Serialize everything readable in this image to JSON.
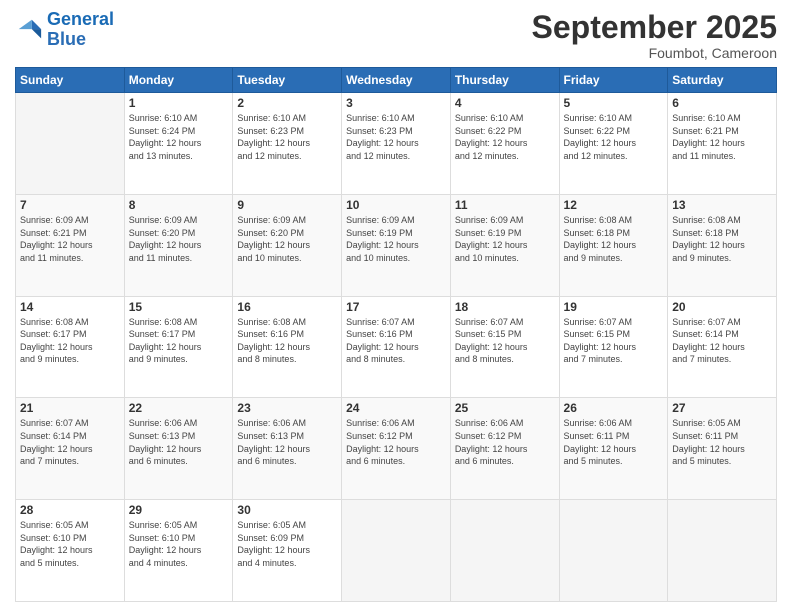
{
  "header": {
    "logo_line1": "General",
    "logo_line2": "Blue",
    "month": "September 2025",
    "location": "Foumbot, Cameroon"
  },
  "weekdays": [
    "Sunday",
    "Monday",
    "Tuesday",
    "Wednesday",
    "Thursday",
    "Friday",
    "Saturday"
  ],
  "weeks": [
    [
      {
        "day": "",
        "info": ""
      },
      {
        "day": "1",
        "info": "Sunrise: 6:10 AM\nSunset: 6:24 PM\nDaylight: 12 hours\nand 13 minutes."
      },
      {
        "day": "2",
        "info": "Sunrise: 6:10 AM\nSunset: 6:23 PM\nDaylight: 12 hours\nand 12 minutes."
      },
      {
        "day": "3",
        "info": "Sunrise: 6:10 AM\nSunset: 6:23 PM\nDaylight: 12 hours\nand 12 minutes."
      },
      {
        "day": "4",
        "info": "Sunrise: 6:10 AM\nSunset: 6:22 PM\nDaylight: 12 hours\nand 12 minutes."
      },
      {
        "day": "5",
        "info": "Sunrise: 6:10 AM\nSunset: 6:22 PM\nDaylight: 12 hours\nand 12 minutes."
      },
      {
        "day": "6",
        "info": "Sunrise: 6:10 AM\nSunset: 6:21 PM\nDaylight: 12 hours\nand 11 minutes."
      }
    ],
    [
      {
        "day": "7",
        "info": "Sunrise: 6:09 AM\nSunset: 6:21 PM\nDaylight: 12 hours\nand 11 minutes."
      },
      {
        "day": "8",
        "info": "Sunrise: 6:09 AM\nSunset: 6:20 PM\nDaylight: 12 hours\nand 11 minutes."
      },
      {
        "day": "9",
        "info": "Sunrise: 6:09 AM\nSunset: 6:20 PM\nDaylight: 12 hours\nand 10 minutes."
      },
      {
        "day": "10",
        "info": "Sunrise: 6:09 AM\nSunset: 6:19 PM\nDaylight: 12 hours\nand 10 minutes."
      },
      {
        "day": "11",
        "info": "Sunrise: 6:09 AM\nSunset: 6:19 PM\nDaylight: 12 hours\nand 10 minutes."
      },
      {
        "day": "12",
        "info": "Sunrise: 6:08 AM\nSunset: 6:18 PM\nDaylight: 12 hours\nand 9 minutes."
      },
      {
        "day": "13",
        "info": "Sunrise: 6:08 AM\nSunset: 6:18 PM\nDaylight: 12 hours\nand 9 minutes."
      }
    ],
    [
      {
        "day": "14",
        "info": "Sunrise: 6:08 AM\nSunset: 6:17 PM\nDaylight: 12 hours\nand 9 minutes."
      },
      {
        "day": "15",
        "info": "Sunrise: 6:08 AM\nSunset: 6:17 PM\nDaylight: 12 hours\nand 9 minutes."
      },
      {
        "day": "16",
        "info": "Sunrise: 6:08 AM\nSunset: 6:16 PM\nDaylight: 12 hours\nand 8 minutes."
      },
      {
        "day": "17",
        "info": "Sunrise: 6:07 AM\nSunset: 6:16 PM\nDaylight: 12 hours\nand 8 minutes."
      },
      {
        "day": "18",
        "info": "Sunrise: 6:07 AM\nSunset: 6:15 PM\nDaylight: 12 hours\nand 8 minutes."
      },
      {
        "day": "19",
        "info": "Sunrise: 6:07 AM\nSunset: 6:15 PM\nDaylight: 12 hours\nand 7 minutes."
      },
      {
        "day": "20",
        "info": "Sunrise: 6:07 AM\nSunset: 6:14 PM\nDaylight: 12 hours\nand 7 minutes."
      }
    ],
    [
      {
        "day": "21",
        "info": "Sunrise: 6:07 AM\nSunset: 6:14 PM\nDaylight: 12 hours\nand 7 minutes."
      },
      {
        "day": "22",
        "info": "Sunrise: 6:06 AM\nSunset: 6:13 PM\nDaylight: 12 hours\nand 6 minutes."
      },
      {
        "day": "23",
        "info": "Sunrise: 6:06 AM\nSunset: 6:13 PM\nDaylight: 12 hours\nand 6 minutes."
      },
      {
        "day": "24",
        "info": "Sunrise: 6:06 AM\nSunset: 6:12 PM\nDaylight: 12 hours\nand 6 minutes."
      },
      {
        "day": "25",
        "info": "Sunrise: 6:06 AM\nSunset: 6:12 PM\nDaylight: 12 hours\nand 6 minutes."
      },
      {
        "day": "26",
        "info": "Sunrise: 6:06 AM\nSunset: 6:11 PM\nDaylight: 12 hours\nand 5 minutes."
      },
      {
        "day": "27",
        "info": "Sunrise: 6:05 AM\nSunset: 6:11 PM\nDaylight: 12 hours\nand 5 minutes."
      }
    ],
    [
      {
        "day": "28",
        "info": "Sunrise: 6:05 AM\nSunset: 6:10 PM\nDaylight: 12 hours\nand 5 minutes."
      },
      {
        "day": "29",
        "info": "Sunrise: 6:05 AM\nSunset: 6:10 PM\nDaylight: 12 hours\nand 4 minutes."
      },
      {
        "day": "30",
        "info": "Sunrise: 6:05 AM\nSunset: 6:09 PM\nDaylight: 12 hours\nand 4 minutes."
      },
      {
        "day": "",
        "info": ""
      },
      {
        "day": "",
        "info": ""
      },
      {
        "day": "",
        "info": ""
      },
      {
        "day": "",
        "info": ""
      }
    ]
  ]
}
